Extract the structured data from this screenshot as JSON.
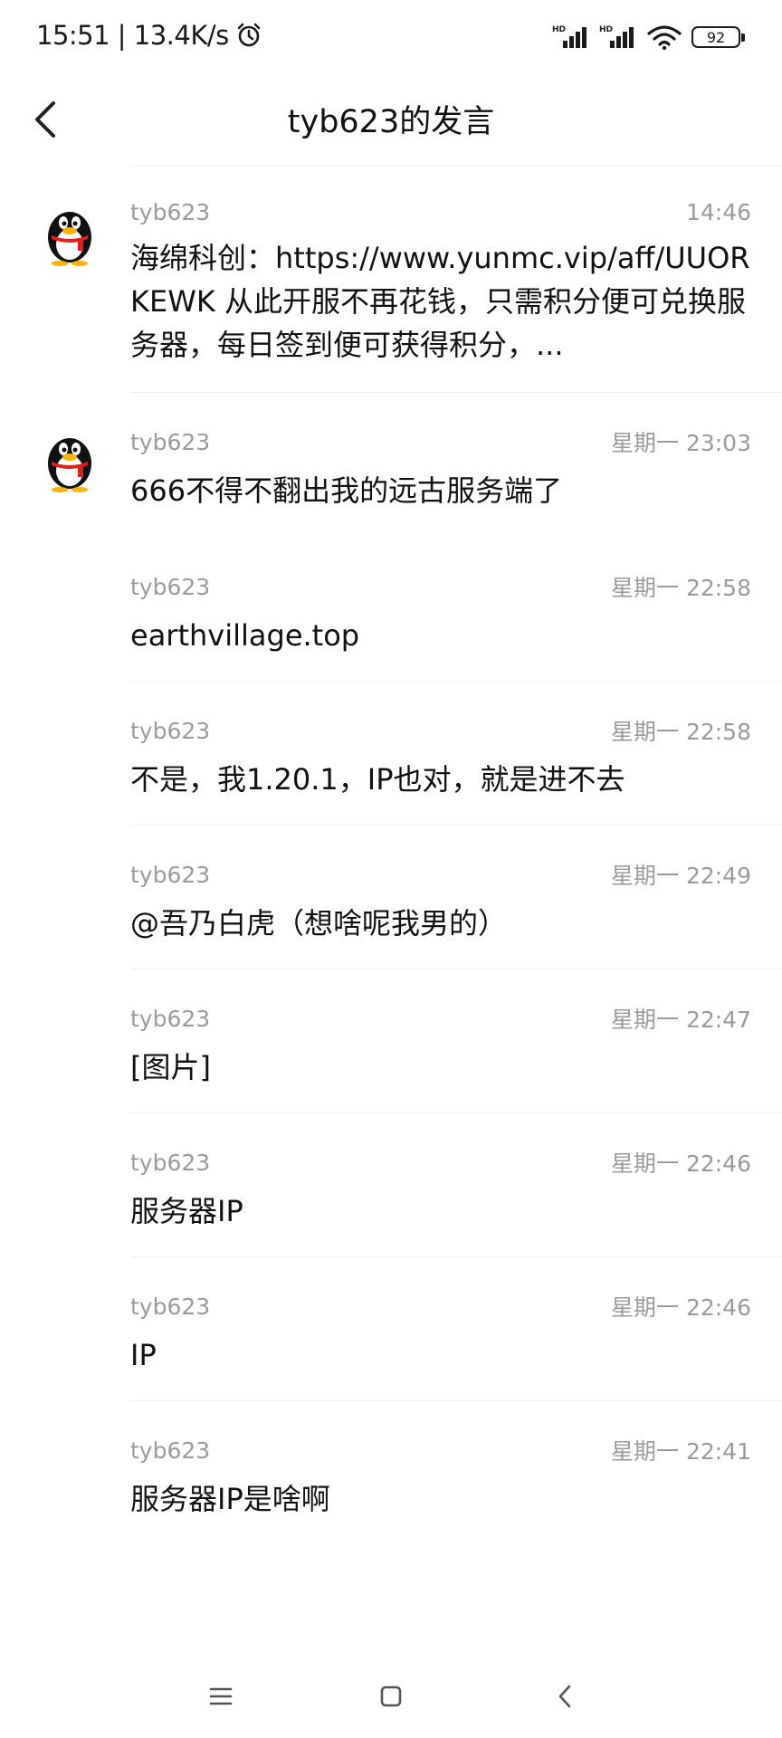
{
  "status_bar": {
    "time_speed": "15:51 | 13.4K/s",
    "battery": "92",
    "icons": [
      "alarm-icon",
      "signal-hd-icon",
      "signal-hd-icon",
      "wifi-icon",
      "battery-icon"
    ]
  },
  "header": {
    "title": "tyb623的发言",
    "back_icon": "chevron-left-icon"
  },
  "messages": [
    {
      "author": "tyb623",
      "time": "14:46",
      "text": "海绵科创：https://www.yunmc.vip/aff/UUORKEWK 从此开服不再花钱，只需积分便可兑换服务器，每日签到便可获得积分，...",
      "has_avatar": true
    },
    {
      "author": "tyb623",
      "time": "星期一 23:03",
      "text": "666不得不翻出我的远古服务端了",
      "has_avatar": true
    },
    {
      "author": "tyb623",
      "time": "星期一 22:58",
      "text": "earthvillage.top",
      "has_avatar": false
    },
    {
      "author": "tyb623",
      "time": "星期一 22:58",
      "text": "不是，我1.20.1，IP也对，就是进不去",
      "has_avatar": false
    },
    {
      "author": "tyb623",
      "time": "星期一 22:49",
      "text": "@吾乃白虎（想啥呢我男的）",
      "has_avatar": false
    },
    {
      "author": "tyb623",
      "time": "星期一 22:47",
      "text": "[图片]",
      "has_avatar": false
    },
    {
      "author": "tyb623",
      "time": "星期一 22:46",
      "text": "服务器IP",
      "has_avatar": false
    },
    {
      "author": "tyb623",
      "time": "星期一 22:46",
      "text": "IP",
      "has_avatar": false
    },
    {
      "author": "tyb623",
      "time": "星期一 22:41",
      "text": "服务器IP是啥啊",
      "has_avatar": false
    }
  ],
  "nav_bar": {
    "icons": [
      "menu-icon",
      "home-square-icon",
      "back-triangle-icon"
    ]
  }
}
